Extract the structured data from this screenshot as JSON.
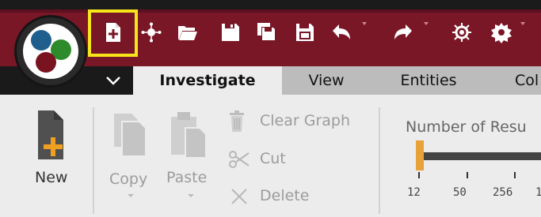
{
  "tabs": [
    {
      "label": "Investigate",
      "active": true
    },
    {
      "label": "View",
      "active": false
    },
    {
      "label": "Entities",
      "active": false
    },
    {
      "label": "Col",
      "active": false
    }
  ],
  "ribbon": {
    "new_label": "New",
    "copy_label": "Copy",
    "paste_label": "Paste",
    "clear_graph_label": "Clear Graph",
    "cut_label": "Cut",
    "delete_label": "Delete",
    "results_label": "Number of Resu",
    "results_ticks": [
      "12",
      "50",
      "256",
      "1"
    ],
    "results_value": "12"
  },
  "colors": {
    "titlebar": "#7a1727",
    "highlight": "#f5e51a",
    "slider_thumb": "#e8a23a",
    "new_plus": "#f0a020"
  },
  "quick_access_icons": [
    "new-graph-icon",
    "layout-icon",
    "open-icon",
    "save-icon",
    "save-all-icon",
    "save-as-icon",
    "undo-icon",
    "redo-icon",
    "transform-icon",
    "settings-icon"
  ]
}
